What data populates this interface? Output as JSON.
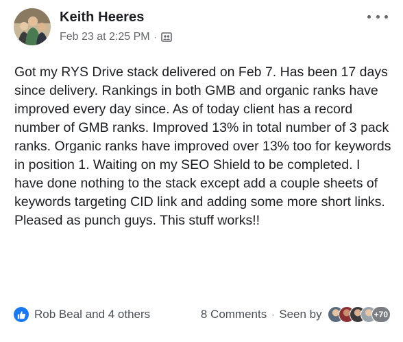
{
  "post": {
    "author": "Keith Heeres",
    "timestamp": "Feb 23 at 2:25 PM",
    "meta_separator": "·",
    "audience_icon": "group-audience-icon",
    "text": "Got my RYS Drive stack delivered on Feb 7. Has been 17 days since delivery. Rankings in both GMB and organic ranks have improved every day since. As of today client has a record number of GMB ranks. Improved 13% in total number of 3 pack ranks. Organic ranks have improved over 13% too for keywords in position 1. Waiting on my SEO Shield to be completed. I have done nothing to the stack except add a couple sheets of keywords targeting CID link and adding some more short links. Pleased as punch guys. This stuff works!!"
  },
  "footer": {
    "likes_label": "Rob Beal and 4 others",
    "comments_label": "8 Comments",
    "separator": "·",
    "seen_by_label": "Seen by",
    "viewer_overflow": "+70"
  },
  "colors": {
    "like_blue": "#1877f2",
    "meta_gray": "#65676b"
  }
}
